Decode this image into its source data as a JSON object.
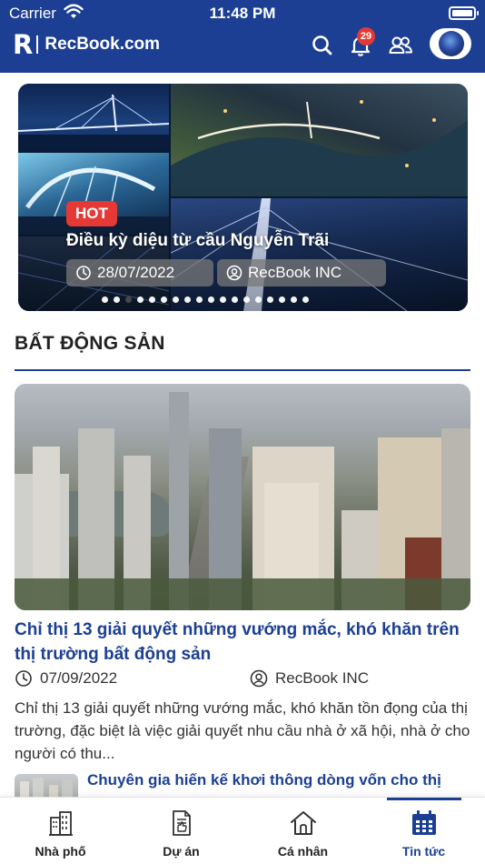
{
  "status_bar": {
    "carrier": "Carrier",
    "time": "11:48 PM"
  },
  "header": {
    "brand": "RecBook.com",
    "logo_mark": "R",
    "notification_count": "29",
    "icons": [
      "search-icon",
      "bell-icon",
      "users-icon"
    ]
  },
  "carousel": {
    "badge": "HOT",
    "title": "Điều kỳ diệu từ cầu Nguyễn Trãi",
    "date": "28/07/2022",
    "author": "RecBook INC",
    "slide_count": 18,
    "active_index": 2
  },
  "section": {
    "title": "BẤT ĐỘNG SẢN"
  },
  "articles": [
    {
      "title": "Chỉ thị 13 giải quyết những vướng mắc, khó khăn trên thị trường bất động sản",
      "date": "07/09/2022",
      "author": "RecBook INC",
      "description": "Chỉ thị 13 giải quyết những vướng mắc, khó khăn tồn đọng của thị trường, đặc biệt là việc giải quyết nhu cầu nhà ở xã hội, nhà ở cho người có thu..."
    },
    {
      "title": "Chuyên gia hiến kế khơi thông dòng vốn cho thị"
    }
  ],
  "tabs": [
    {
      "label": "Nhà phố",
      "icon": "building-icon"
    },
    {
      "label": "Dự án",
      "icon": "document-icon"
    },
    {
      "label": "Cá nhân",
      "icon": "house-icon"
    },
    {
      "label": "Tin tức",
      "icon": "calendar-icon"
    }
  ],
  "colors": {
    "brand": "#1c3f94",
    "hot": "#e53935",
    "badge": "#e53935"
  }
}
